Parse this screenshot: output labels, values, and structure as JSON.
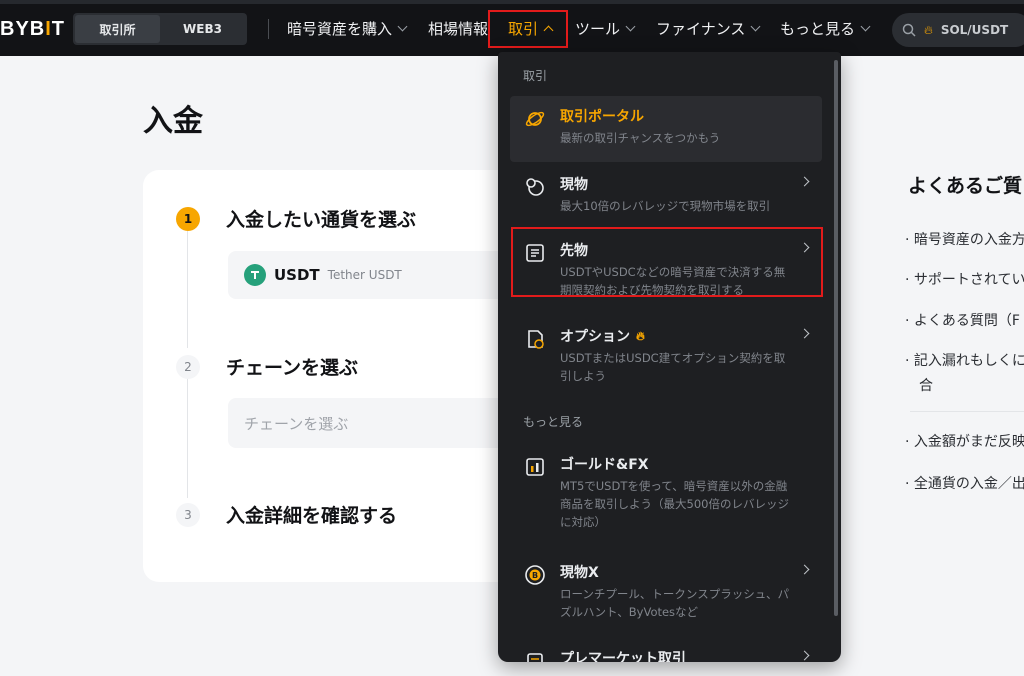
{
  "nav": {
    "logo": "BYBIT",
    "segments": [
      "取引所",
      "WEB3"
    ],
    "items": [
      "暗号資産を購入",
      "相場情報",
      "取引",
      "ツール",
      "ファイナンス",
      "もっと見る"
    ],
    "search_pair": "SOL/USDT"
  },
  "page": {
    "title": "入金",
    "steps": [
      {
        "num": "1",
        "title": "入金したい通貨を選ぶ"
      },
      {
        "num": "2",
        "title": "チェーンを選ぶ"
      },
      {
        "num": "3",
        "title": "入金詳細を確認する"
      }
    ],
    "coin": {
      "symbol": "USDT",
      "name": "Tether USDT"
    },
    "chain_placeholder": "チェーンを選ぶ"
  },
  "faq": {
    "title": "よくあるご質",
    "items": [
      "暗号資産の入金方",
      "サポートされてい",
      "よくある質問（F",
      "記入漏れもしくに",
      "合",
      "入金額がまだ反映",
      "全通貨の入金／出"
    ]
  },
  "dropdown": {
    "section1": "取引",
    "section2": "もっと見る",
    "items": [
      {
        "title": "取引ポータル",
        "desc": "最新の取引チャンスをつかもう"
      },
      {
        "title": "現物",
        "desc": "最大10倍のレバレッジで現物市場を取引"
      },
      {
        "title": "先物",
        "desc": "USDTやUSDCなどの暗号資産で決済する無期限契約および先物契約を取引する"
      },
      {
        "title": "オプション",
        "desc": "USDTまたはUSDC建てオプション契約を取引しよう"
      },
      {
        "title": "ゴールド&FX",
        "desc": "MT5でUSDTを使って、暗号資産以外の金融商品を取引しよう（最大500倍のレバレッジに対応）"
      },
      {
        "title": "現物X",
        "desc": "ローンチプール、トークンスプラッシュ、パズルハント、ByVotesなど"
      },
      {
        "title": "プレマーケット取引",
        "desc": ""
      }
    ]
  },
  "colors": {
    "accent": "#f7a600",
    "highlight_box": "#e21b1b",
    "nav_bg": "#121316",
    "menu_bg": "#1e1f22"
  }
}
